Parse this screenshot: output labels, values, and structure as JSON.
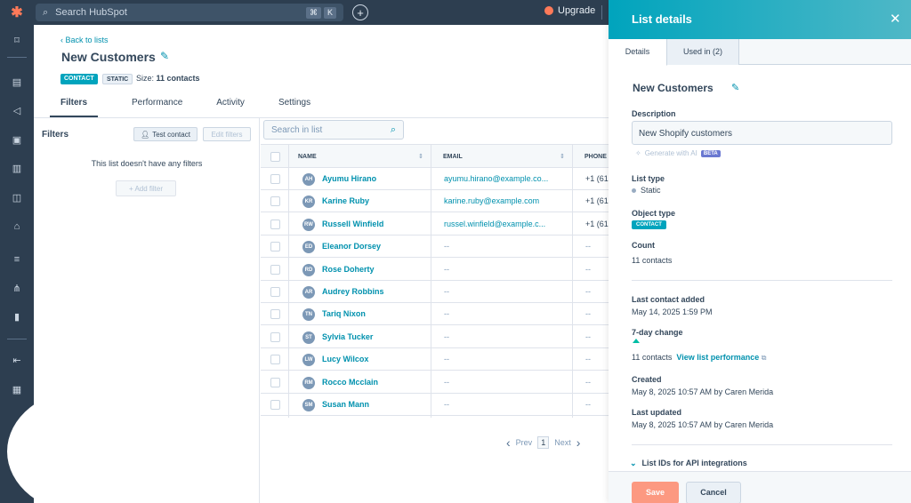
{
  "topbar": {
    "search_placeholder": "Search HubSpot",
    "kbd": [
      "⌘",
      "K"
    ],
    "upgrade_label": "Upgrade"
  },
  "icons": {
    "logo": "hubspot-sprocket-icon",
    "nav": [
      "bookmark-icon",
      "contacts-icon",
      "megaphone-icon",
      "content-icon",
      "commerce-icon",
      "service-icon",
      "automation-icon",
      "database-icon",
      "workflows-icon",
      "reports-icon",
      "collapse-arrow-icon",
      "settings-icon"
    ]
  },
  "colors": {
    "accent": "#00a4bd",
    "link": "#0091ae",
    "primary_button": "#ff7a59",
    "nav_bg": "#2d3e50"
  },
  "main": {
    "back_label": "Back to lists",
    "title": "New Customers",
    "tag_contact": "CONTACT",
    "tag_static": "STATIC",
    "size_prefix": "Size:",
    "size_value": "11 contacts",
    "tabs": [
      {
        "label": "Filters",
        "active": true
      },
      {
        "label": "Performance",
        "active": false
      },
      {
        "label": "Activity",
        "active": false
      },
      {
        "label": "Settings",
        "active": false
      }
    ]
  },
  "filters": {
    "title": "Filters",
    "test_contact_label": "Test contact",
    "edit_filters_label": "Edit filters",
    "empty_message": "This list doesn't have any filters",
    "add_filter_label": "+ Add filter"
  },
  "table": {
    "search_placeholder": "Search in list",
    "columns": [
      "NAME",
      "EMAIL",
      "PHONE"
    ],
    "rows": [
      {
        "initials": "AH",
        "name": "Ayumu Hirano",
        "email": "ayumu.hirano@example.co...",
        "phone": "+1 (61"
      },
      {
        "initials": "KR",
        "name": "Karine Ruby",
        "email": "karine.ruby@example.com",
        "phone": "+1 (61"
      },
      {
        "initials": "RW",
        "name": "Russell Winfield",
        "email": "russel.winfield@example.c...",
        "phone": "+1 (61"
      },
      {
        "initials": "ED",
        "name": "Eleanor Dorsey",
        "email": "--",
        "phone": "--"
      },
      {
        "initials": "RD",
        "name": "Rose Doherty",
        "email": "--",
        "phone": "--"
      },
      {
        "initials": "AR",
        "name": "Audrey Robbins",
        "email": "--",
        "phone": "--"
      },
      {
        "initials": "TN",
        "name": "Tariq Nixon",
        "email": "--",
        "phone": "--"
      },
      {
        "initials": "ST",
        "name": "Sylvia Tucker",
        "email": "--",
        "phone": "--"
      },
      {
        "initials": "LW",
        "name": "Lucy Wilcox",
        "email": "--",
        "phone": "--"
      },
      {
        "initials": "RM",
        "name": "Rocco Mcclain",
        "email": "--",
        "phone": "--"
      },
      {
        "initials": "SM",
        "name": "Susan Mann",
        "email": "--",
        "phone": "--"
      }
    ],
    "pager": {
      "prev": "Prev",
      "page": "1",
      "next": "Next"
    }
  },
  "panel": {
    "title": "List details",
    "tabs": [
      "Details",
      "Used in (2)"
    ],
    "name": "New Customers",
    "description_label": "Description",
    "description_value": "New Shopify customers",
    "generate_ai_label": "Generate with AI",
    "beta_label": "BETA",
    "list_type_label": "List type",
    "list_type_value": "Static",
    "object_type_label": "Object type",
    "object_type_value": "CONTACT",
    "count_label": "Count",
    "count_value": "11 contacts",
    "last_added_label": "Last contact added",
    "last_added_value": "May 14, 2025 1:59 PM",
    "change_label": "7-day change",
    "change_value": "11 contacts",
    "view_performance_label": "View list performance",
    "created_label": "Created",
    "created_value": "May 8, 2025 10:57 AM by Caren Merida",
    "updated_label": "Last updated",
    "updated_value": "May 8, 2025 10:57 AM by Caren Merida",
    "api_label": "List IDs for API integrations",
    "save_label": "Save",
    "cancel_label": "Cancel"
  }
}
